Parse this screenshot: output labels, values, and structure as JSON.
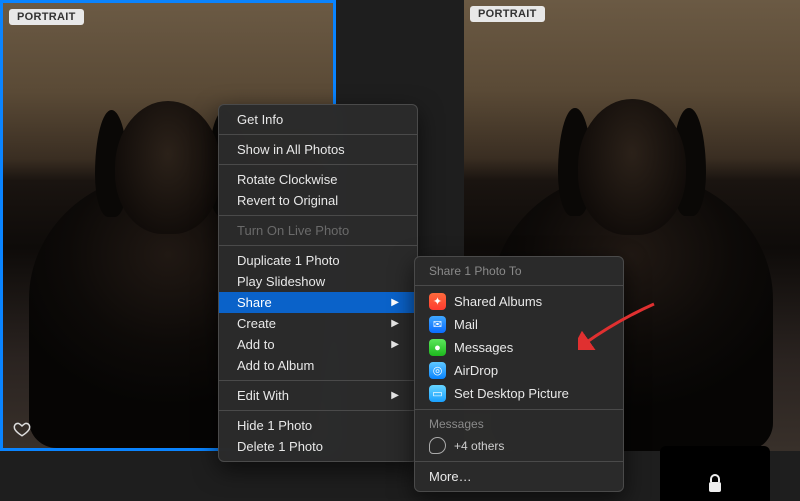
{
  "photos": {
    "badge": "PORTRAIT"
  },
  "context_menu": {
    "get_info": "Get Info",
    "show_in_all": "Show in All Photos",
    "rotate": "Rotate Clockwise",
    "revert": "Revert to Original",
    "live_photo": "Turn On Live Photo",
    "duplicate": "Duplicate 1 Photo",
    "slideshow": "Play Slideshow",
    "share": "Share",
    "create": "Create",
    "add_to": "Add to",
    "add_to_album": "Add to Album",
    "edit_with": "Edit With",
    "hide": "Hide 1 Photo",
    "delete": "Delete 1 Photo"
  },
  "share_submenu": {
    "header": "Share 1 Photo To",
    "shared_albums": "Shared Albums",
    "mail": "Mail",
    "messages": "Messages",
    "airdrop": "AirDrop",
    "set_desktop": "Set Desktop Picture",
    "messages_section": "Messages",
    "others": "+4 others",
    "more": "More…"
  }
}
